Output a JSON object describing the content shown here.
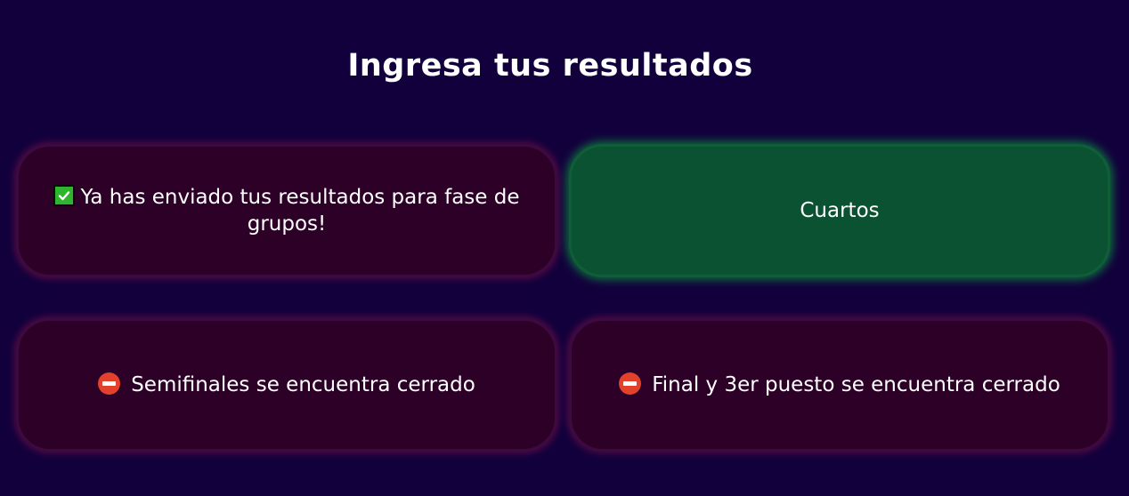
{
  "page": {
    "title": "Ingresa tus resultados"
  },
  "cards": [
    {
      "status": "submitted",
      "icon": "check-icon",
      "text": "Ya has enviado tus resultados para fase de grupos!"
    },
    {
      "status": "open",
      "text": "Cuartos"
    },
    {
      "status": "closed",
      "icon": "no-entry-icon",
      "text": "Semifinales se encuentra cerrado"
    },
    {
      "status": "closed",
      "icon": "no-entry-icon",
      "text": "Final y 3er puesto se encuentra cerrado"
    }
  ],
  "colors": {
    "background": "#12003c",
    "closed_card": "#2c0027",
    "open_card": "#0b5232",
    "check_green": "#2eb52e",
    "stop_red": "#e2412b"
  }
}
